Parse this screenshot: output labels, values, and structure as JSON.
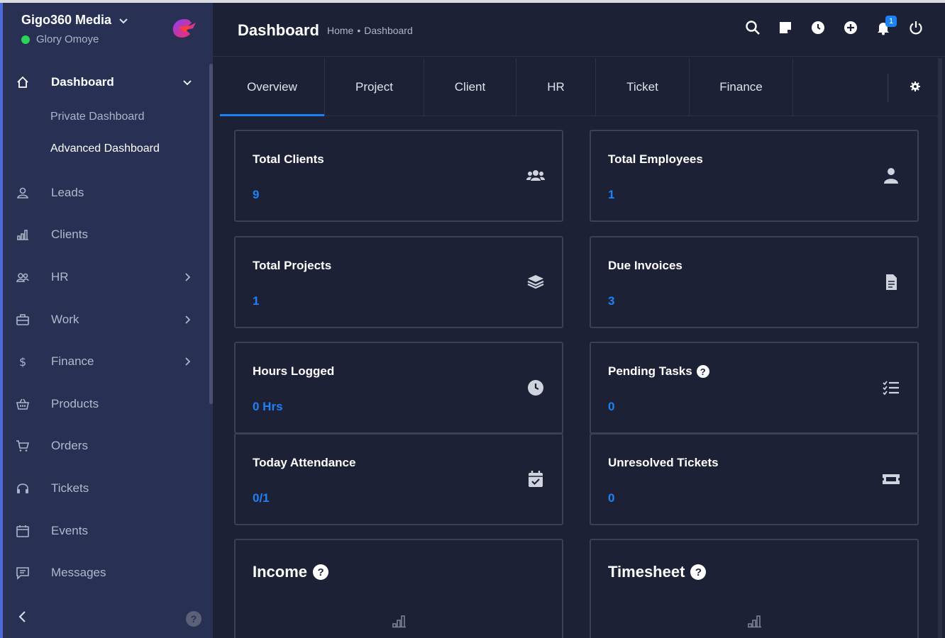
{
  "sidebar": {
    "company": "Gigo360 Media",
    "user": "Glory Omoye",
    "items": [
      {
        "label": "Dashboard",
        "icon": "home-icon",
        "has_chevron": true,
        "active": true
      },
      {
        "label": "Leads",
        "icon": "user-icon"
      },
      {
        "label": "Clients",
        "icon": "bar-chart-icon"
      },
      {
        "label": "HR",
        "icon": "users-icon",
        "has_chevron": true
      },
      {
        "label": "Work",
        "icon": "briefcase-icon",
        "has_chevron": true
      },
      {
        "label": "Finance",
        "icon": "dollar-icon",
        "has_chevron": true
      },
      {
        "label": "Products",
        "icon": "basket-icon"
      },
      {
        "label": "Orders",
        "icon": "cart-icon"
      },
      {
        "label": "Tickets",
        "icon": "headset-icon"
      },
      {
        "label": "Events",
        "icon": "calendar-icon"
      },
      {
        "label": "Messages",
        "icon": "message-icon"
      }
    ],
    "sub_items": [
      {
        "label": "Private Dashboard"
      },
      {
        "label": "Advanced Dashboard",
        "active": true
      }
    ],
    "help": "?"
  },
  "header": {
    "title": "Dashboard",
    "breadcrumb": [
      "Home",
      "•",
      "Dashboard"
    ],
    "icons": [
      "search-icon",
      "sticky-note-icon",
      "clock-icon",
      "plus-circle-icon",
      "bell-icon",
      "power-icon"
    ],
    "notification_count": "1"
  },
  "tabs": [
    "Overview",
    "Project",
    "Client",
    "HR",
    "Ticket",
    "Finance"
  ],
  "cards": [
    {
      "title": "Total Clients",
      "value": "9",
      "icon": "users-icon"
    },
    {
      "title": "Total Employees",
      "value": "1",
      "icon": "user-icon"
    },
    {
      "title": "Total Projects",
      "value": "1",
      "icon": "layers-icon"
    },
    {
      "title": "Due Invoices",
      "value": "3",
      "icon": "file-icon"
    },
    {
      "title": "Hours Logged",
      "value": "0 Hrs",
      "icon": "clock-icon"
    },
    {
      "title": "Pending Tasks",
      "value": "0",
      "icon": "tasks-icon",
      "help": "?"
    },
    {
      "title": "Today Attendance",
      "value": "0/1",
      "icon": "calendar-check-icon"
    },
    {
      "title": "Unresolved Tickets",
      "value": "0",
      "icon": "ticket-icon"
    }
  ],
  "widgets": [
    {
      "title": "Income",
      "help": "?"
    },
    {
      "title": "Timesheet",
      "help": "?"
    }
  ],
  "colors": {
    "accent": "#1d82f5",
    "background": "#1d2135",
    "sidebar": "#283154",
    "online": "#2bd35a"
  }
}
